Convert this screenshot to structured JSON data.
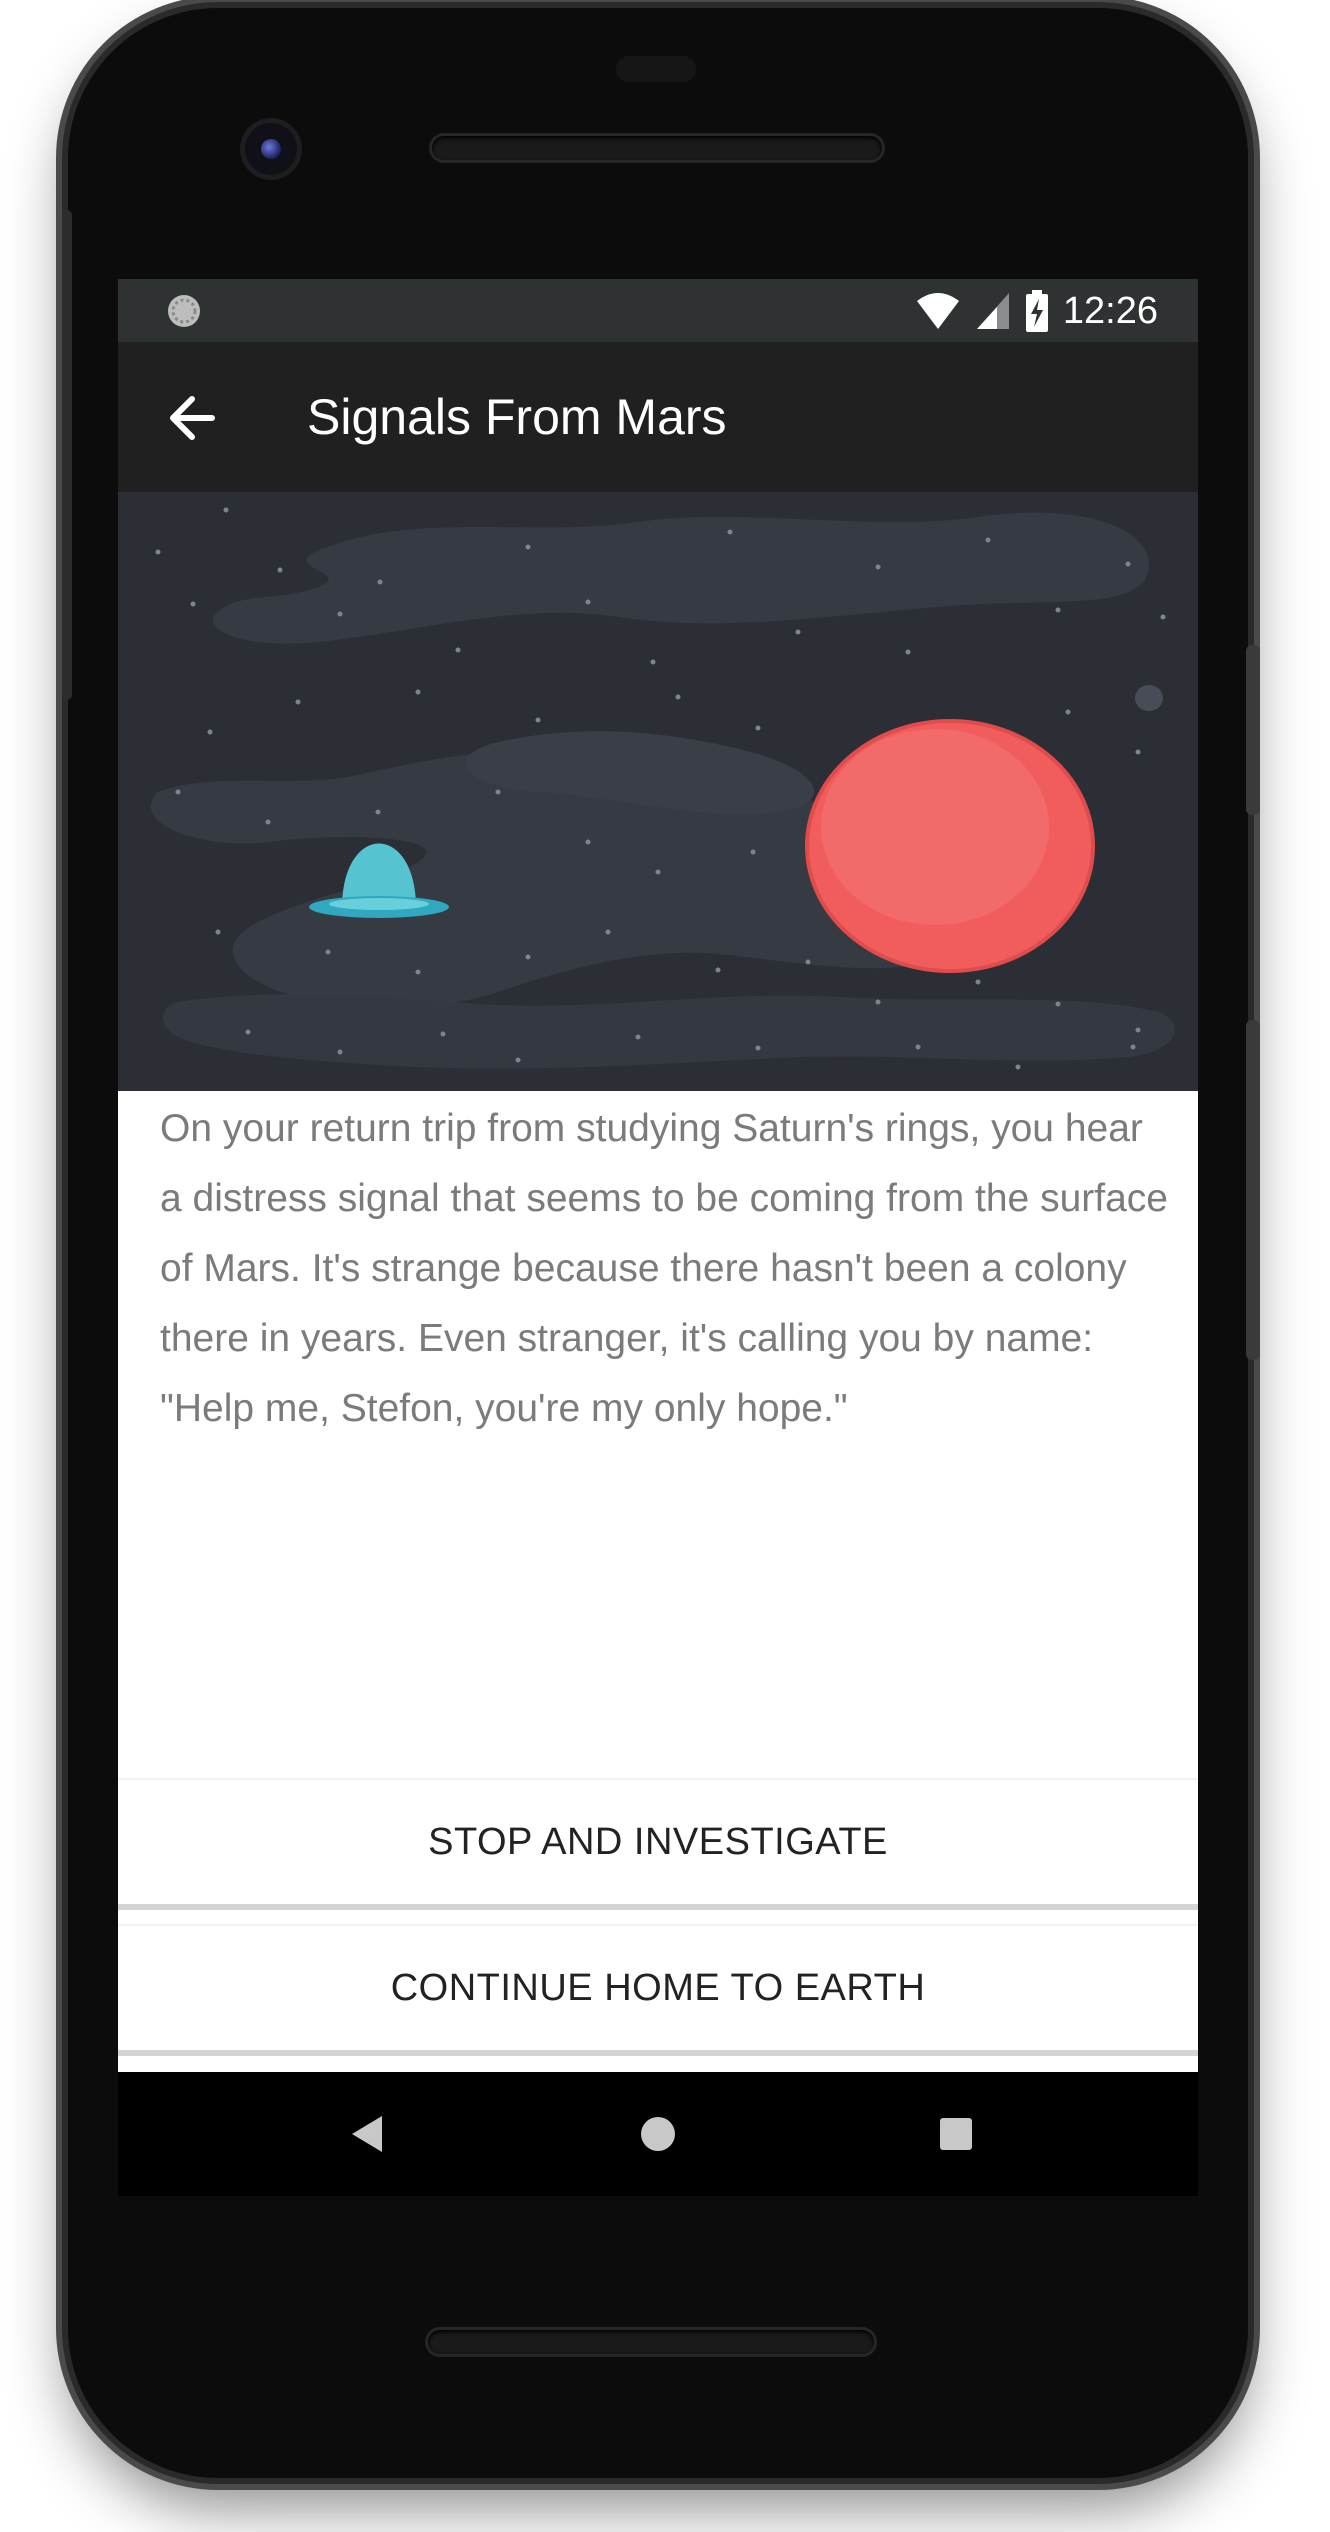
{
  "status_bar": {
    "time": "12:26",
    "icons": [
      "notification-icon",
      "wifi-icon",
      "cell-signal-icon",
      "battery-charging-icon"
    ]
  },
  "toolbar": {
    "title": "Signals From Mars",
    "back_icon": "arrow-back-icon"
  },
  "illustration": {
    "background_color": "#2b2e35",
    "planet_color": "#f15d5d",
    "ship_color": "#4fbccb"
  },
  "story": {
    "text": "On your return trip from studying Saturn's rings, you hear a distress signal that seems to be coming from the surface of Mars. It's strange because there hasn't been a colony there in years. Even stranger, it's calling you by name: \"Help me, Stefon, you're my only hope.\""
  },
  "choices": [
    {
      "label": "STOP AND INVESTIGATE"
    },
    {
      "label": "CONTINUE HOME TO EARTH"
    }
  ],
  "nav_bar": {
    "buttons": [
      "back-triangle-icon",
      "home-circle-icon",
      "recents-square-icon"
    ]
  }
}
